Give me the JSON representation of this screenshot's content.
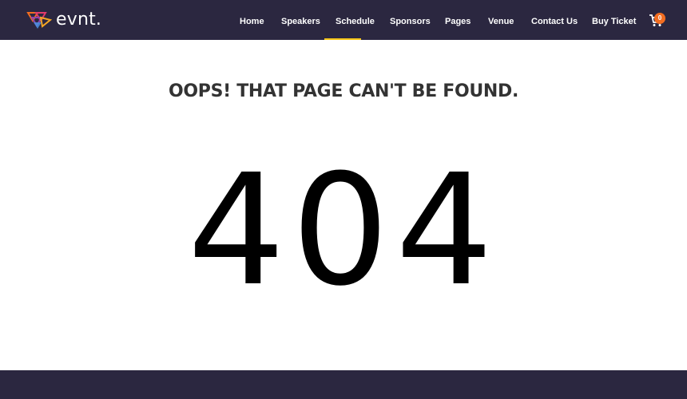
{
  "header": {
    "logo_text": "evnt.",
    "nav": [
      {
        "label": "Home"
      },
      {
        "label": "Speakers"
      },
      {
        "label": "Schedule"
      },
      {
        "label": "Sponsors"
      },
      {
        "label": "Pages"
      },
      {
        "label": "Venue"
      },
      {
        "label": "Contact Us"
      },
      {
        "label": "Buy Ticket"
      }
    ],
    "cart": {
      "icon": "cart-icon",
      "count": "0"
    }
  },
  "main": {
    "title": "OOPS! THAT PAGE CAN'T BE FOUND.",
    "code": "404"
  },
  "colors": {
    "header_bg": "#2b2740",
    "accent": "#f26d21",
    "active": "#f5c518"
  }
}
